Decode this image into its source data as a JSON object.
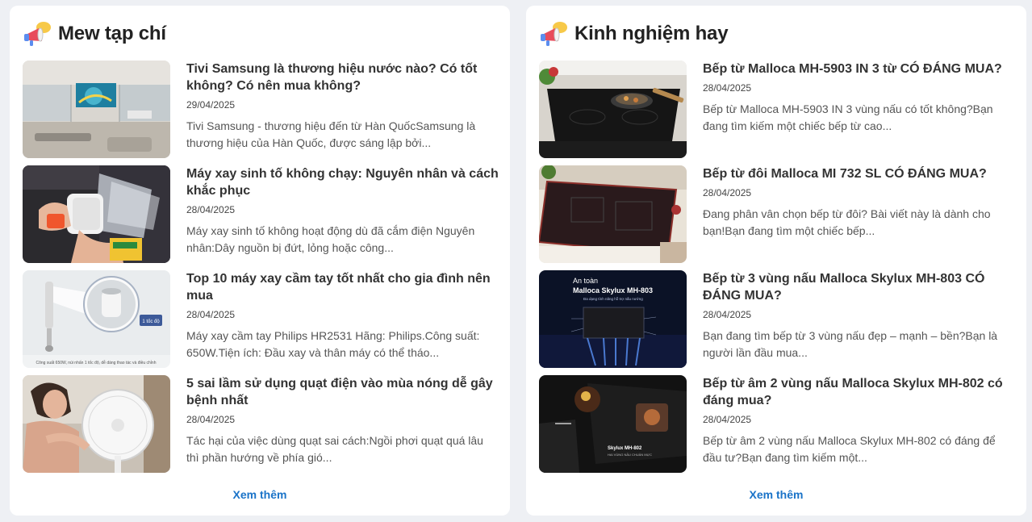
{
  "panels": [
    {
      "title": "Mew tạp chí",
      "icon": "megaphone-icon",
      "see_more": "Xem thêm",
      "articles": [
        {
          "title": "Tivi Samsung là thương hiệu nước nào? Có tốt không? Có nên mua không?",
          "date": "29/04/2025",
          "excerpt": "Tivi Samsung - thương hiệu đến từ Hàn QuốcSamsung là thương hiệu của Hàn Quốc, được sáng lập bởi...",
          "image": "tv-livingroom-image"
        },
        {
          "title": "Máy xay sinh tố không chạy: Nguyên nhân và cách khắc phục",
          "date": "28/04/2025",
          "excerpt": "Máy xay sinh tố không hoạt động dù đã cắm điện Nguyên nhân:Dây nguồn bị đứt, lỏng hoặc công...",
          "image": "blender-image"
        },
        {
          "title": "Top 10 máy xay cầm tay tốt nhất cho gia đình nên mua",
          "date": "28/04/2025",
          "excerpt": "Máy xay cầm tay Philips HR2531 Hãng: Philips.Công suất: 650W.Tiện ích: Đầu xay và thân máy có thể tháo...",
          "image": "hand-blender-image",
          "image_caption": "Công suất 650W, núi nhấn 1 tốc độ, dễ dàng thao tác và điều chỉnh",
          "image_badge": "1 tốc độ"
        },
        {
          "title": "5 sai lầm sử dụng quạt điện vào mùa nóng dễ gây bệnh nhất",
          "date": "28/04/2025",
          "excerpt": "Tác hại của việc dùng quạt sai cách:Ngồi phơi quạt quá lâu thì phần hướng về phía gió...",
          "image": "electric-fan-image"
        }
      ]
    },
    {
      "title": "Kinh nghiệm hay",
      "icon": "megaphone-icon",
      "see_more": "Xem thêm",
      "articles": [
        {
          "title": "Bếp từ Malloca MH-5903 IN 3 từ CÓ ĐÁNG MUA?",
          "date": "28/04/2025",
          "excerpt": "Bếp từ Malloca MH-5903 IN 3 vùng nấu có tốt không?Bạn đang tìm kiếm một chiếc bếp từ cao...",
          "image": "induction-cooktop-image"
        },
        {
          "title": "Bếp từ đôi Malloca MI 732 SL CÓ ĐÁNG MUA?",
          "date": "28/04/2025",
          "excerpt": "Đang phân vân chọn bếp từ đôi? Bài viết này là dành cho bạn!Bạn đang tìm một chiếc bếp...",
          "image": "double-cooktop-image"
        },
        {
          "title": "Bếp từ 3 vùng nấu Malloca Skylux MH-803 CÓ ĐÁNG MUA?",
          "date": "28/04/2025",
          "excerpt": "Bạn đang tìm bếp từ 3 vùng nấu đẹp – mạnh – bền?Bạn là người lần đầu mua...",
          "image": "skylux-803-promo-image",
          "image_heading_1": "An toàn",
          "image_heading_2": "Malloca Skylux MH-803",
          "image_subheading": "Đa dạng tính năng hỗ trợ nấu nướng"
        },
        {
          "title": "Bếp từ âm 2 vùng nấu Malloca Skylux MH-802 có đáng mua?",
          "date": "28/04/2025",
          "excerpt": "Bếp từ âm 2 vùng nấu Malloca Skylux MH-802 có đáng để đầu tư?Bạn đang tìm kiếm một...",
          "image": "skylux-802-image",
          "image_heading": "Skylux MH-802",
          "image_subheading": "HAI VÙNG NẤU CHUẨN MỰC"
        }
      ]
    }
  ]
}
